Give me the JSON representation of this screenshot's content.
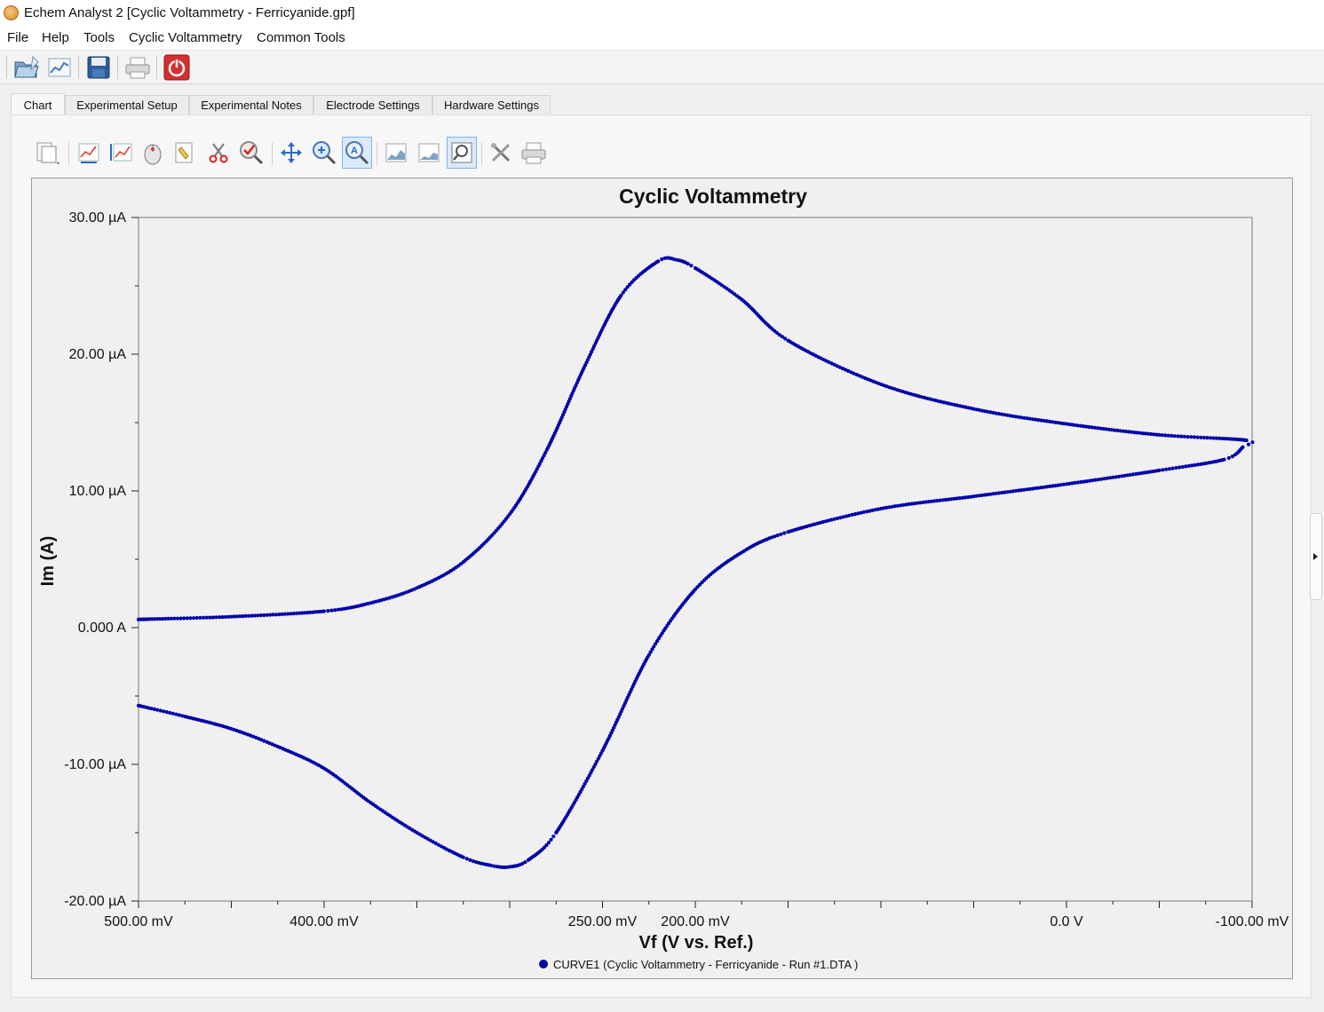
{
  "window": {
    "title": "Echem Analyst 2 [Cyclic Voltammetry - Ferricyanide.gpf]"
  },
  "menu": [
    {
      "label": "File"
    },
    {
      "label": "Help"
    },
    {
      "label": "Tools"
    },
    {
      "label": "Cyclic Voltammetry"
    },
    {
      "label": "Common Tools"
    }
  ],
  "toolbar": {
    "buttons": [
      "open-folder-icon",
      "chart-icon",
      "save-icon",
      "print-icon",
      "power-icon"
    ]
  },
  "tabs": [
    {
      "label": "Chart",
      "active": true
    },
    {
      "label": "Experimental Setup"
    },
    {
      "label": "Experimental Notes"
    },
    {
      "label": "Electrode Settings"
    },
    {
      "label": "Hardware Settings"
    }
  ],
  "chart_tools": [
    "copy-icon",
    "chart-select-icon",
    "chart-range-icon",
    "mouse-icon",
    "highlight-icon",
    "cut-icon",
    "check-zoom-icon",
    "pan-icon",
    "zoom-in-icon",
    "zoom-auto-icon",
    "chart-area-icon",
    "chart-area2-icon",
    "zoom-box-icon",
    "settings-icon",
    "print-icon"
  ],
  "colors": {
    "series": "#0000aa",
    "plot_bg": "#f0f0f0",
    "power_button": "#d32f2f"
  },
  "chart_data": {
    "type": "scatter",
    "title": "Cyclic Voltammetry",
    "xlabel": "Vf (V vs. Ref.)",
    "ylabel": "Im (A)",
    "x_unit": "mV",
    "y_unit": "µA",
    "xlim": [
      500,
      -100
    ],
    "ylim": [
      -20,
      30
    ],
    "x_reversed": true,
    "x_ticks": [
      {
        "value": 500,
        "label": "500.00 mV"
      },
      {
        "value": 400,
        "label": "400.00 mV"
      },
      {
        "value": 250,
        "label": "250.00 mV"
      },
      {
        "value": 200,
        "label": "200.00 mV"
      },
      {
        "value": 0,
        "label": "0.0 V"
      },
      {
        "value": -100,
        "label": "-100.00 mV"
      }
    ],
    "y_ticks": [
      {
        "value": 30,
        "label": "30.00 µA"
      },
      {
        "value": 20,
        "label": "20.00 µA"
      },
      {
        "value": 10,
        "label": "10.00 µA"
      },
      {
        "value": 0,
        "label": "0.000 A"
      },
      {
        "value": -10,
        "label": "-10.00 µA"
      },
      {
        "value": -20,
        "label": "-20.00 µA"
      }
    ],
    "legend": {
      "position": "bottom",
      "label": "CURVE1 (Cyclic Voltammetry - Ferricyanide - Run #1.DTA )"
    },
    "series": [
      {
        "name": "CURVE1 (Cyclic Voltammetry - Ferricyanide - Run #1.DTA )",
        "keypoints": [
          {
            "x": 500,
            "y": 0.6
          },
          {
            "x": 450,
            "y": 0.8
          },
          {
            "x": 400,
            "y": 1.2
          },
          {
            "x": 375,
            "y": 1.8
          },
          {
            "x": 350,
            "y": 2.9
          },
          {
            "x": 325,
            "y": 4.8
          },
          {
            "x": 300,
            "y": 8.3
          },
          {
            "x": 280,
            "y": 13.0
          },
          {
            "x": 260,
            "y": 19.0
          },
          {
            "x": 240,
            "y": 24.3
          },
          {
            "x": 220,
            "y": 26.8
          },
          {
            "x": 210,
            "y": 26.9
          },
          {
            "x": 200,
            "y": 26.3
          },
          {
            "x": 175,
            "y": 24.0
          },
          {
            "x": 150,
            "y": 21.0
          },
          {
            "x": 100,
            "y": 17.8
          },
          {
            "x": 50,
            "y": 16.0
          },
          {
            "x": 0,
            "y": 14.9
          },
          {
            "x": -50,
            "y": 14.1
          },
          {
            "x": -97,
            "y": 13.7
          },
          {
            "x": -95,
            "y": 13.2
          },
          {
            "x": -85,
            "y": 12.3
          },
          {
            "x": -50,
            "y": 11.5
          },
          {
            "x": 0,
            "y": 10.5
          },
          {
            "x": 50,
            "y": 9.6
          },
          {
            "x": 100,
            "y": 8.7
          },
          {
            "x": 150,
            "y": 7.0
          },
          {
            "x": 175,
            "y": 5.5
          },
          {
            "x": 200,
            "y": 2.8
          },
          {
            "x": 225,
            "y": -2.0
          },
          {
            "x": 250,
            "y": -9.0
          },
          {
            "x": 275,
            "y": -15.0
          },
          {
            "x": 290,
            "y": -17.0
          },
          {
            "x": 300,
            "y": -17.5
          },
          {
            "x": 310,
            "y": -17.4
          },
          {
            "x": 325,
            "y": -16.8
          },
          {
            "x": 350,
            "y": -15.0
          },
          {
            "x": 375,
            "y": -12.8
          },
          {
            "x": 400,
            "y": -10.3
          },
          {
            "x": 425,
            "y": -8.7
          },
          {
            "x": 450,
            "y": -7.4
          },
          {
            "x": 475,
            "y": -6.5
          },
          {
            "x": 500,
            "y": -5.7
          }
        ]
      }
    ]
  }
}
